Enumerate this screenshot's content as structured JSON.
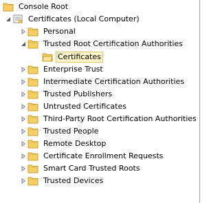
{
  "tree": {
    "root": {
      "label": "Console Root",
      "icon": "folder-icon"
    },
    "computer": {
      "label": "Certificates (Local Computer)",
      "icon": "certificate-store-icon",
      "expanded": true
    },
    "stores": [
      {
        "label": "Personal",
        "icon": "folder-icon",
        "expanded": false
      },
      {
        "label": "Trusted Root Certification Authorities",
        "icon": "folder-icon",
        "expanded": true
      },
      {
        "label": "Certificates",
        "icon": "folder-open-icon",
        "selected": true
      },
      {
        "label": "Enterprise Trust",
        "icon": "folder-icon",
        "expanded": false
      },
      {
        "label": "Intermediate Certification Authorities",
        "icon": "folder-icon",
        "expanded": false
      },
      {
        "label": "Trusted Publishers",
        "icon": "folder-icon",
        "expanded": false
      },
      {
        "label": "Untrusted Certificates",
        "icon": "folder-icon",
        "expanded": false
      },
      {
        "label": "Third-Party Root Certification Authorities",
        "icon": "folder-icon",
        "expanded": false
      },
      {
        "label": "Trusted People",
        "icon": "folder-icon",
        "expanded": false
      },
      {
        "label": "Remote Desktop",
        "icon": "folder-icon",
        "expanded": false
      },
      {
        "label": "Certificate Enrollment Requests",
        "icon": "folder-icon",
        "expanded": false
      },
      {
        "label": "Smart Card Trusted Roots",
        "icon": "folder-icon",
        "expanded": false
      },
      {
        "label": "Trusted Devices",
        "icon": "folder-icon",
        "expanded": false
      }
    ]
  },
  "colors": {
    "selection_fill": "#fff3c7",
    "selection_border": "#d9c77c",
    "folder_fill": "#f5cf66",
    "folder_stroke": "#c79c2b",
    "expander_stroke": "#7a7a7a"
  }
}
